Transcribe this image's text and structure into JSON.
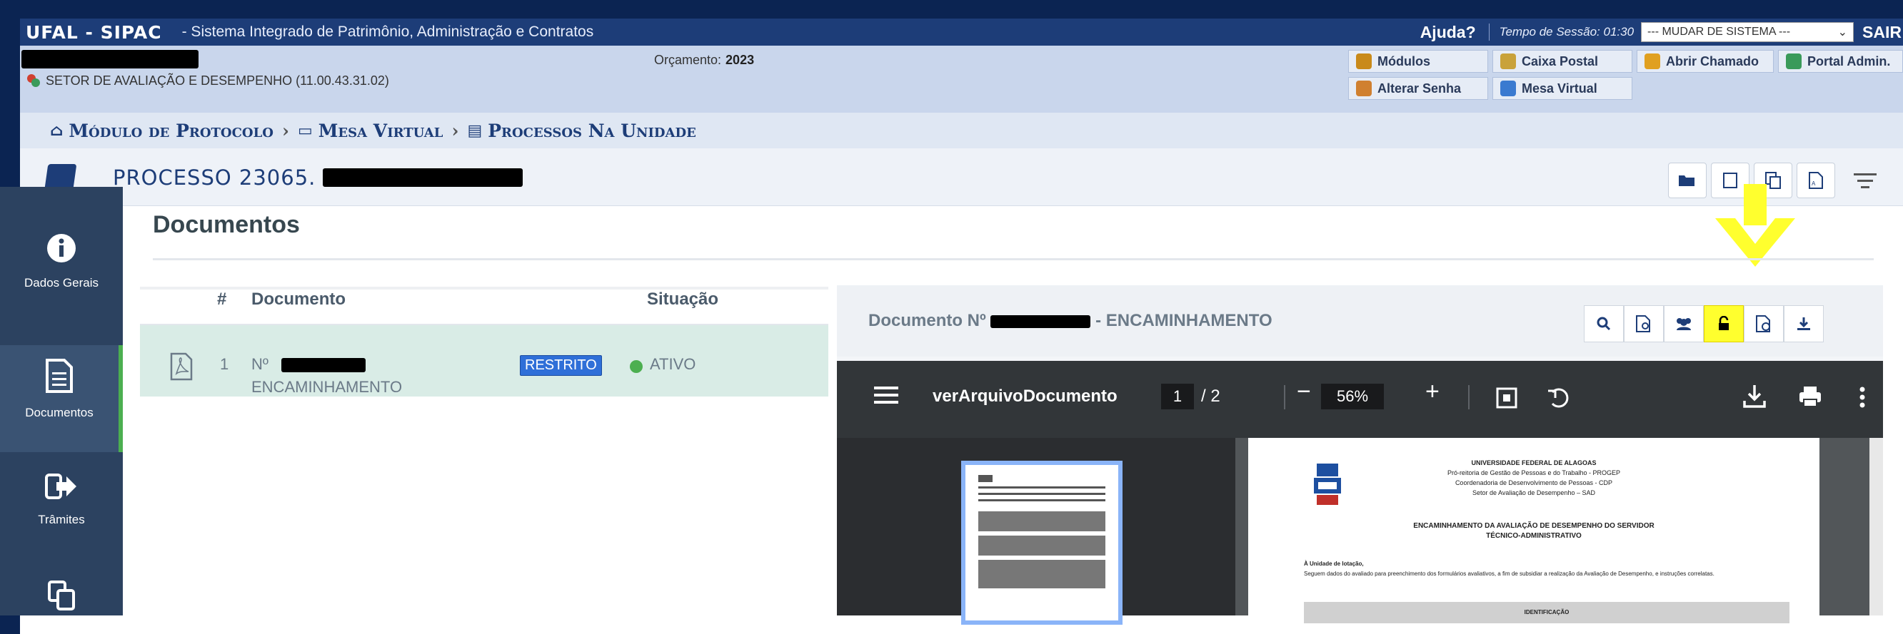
{
  "topbar": {
    "brand": "UFAL - SIPAC",
    "subtitle": "- Sistema Integrado de Patrimônio, Administração e Contratos",
    "help": "Ajuda?",
    "session": "Tempo de Sessão: 01:30",
    "system_select": "--- MUDAR DE SISTEMA ---",
    "exit": "SAIR"
  },
  "info": {
    "unit": "SETOR DE AVALIAÇÃO E DESEMPENHO (11.00.43.31.02)",
    "budget_label": "Orçamento:",
    "budget_year": "2023"
  },
  "quick_links": [
    {
      "label": "Módulos",
      "icon": "cube-icon",
      "color": "#c98a1a"
    },
    {
      "label": "Caixa Postal",
      "icon": "mailbox-icon",
      "color": "#c9a23a"
    },
    {
      "label": "Abrir Chamado",
      "icon": "megaphone-icon",
      "color": "#e0a020"
    },
    {
      "label": "Portal Admin.",
      "icon": "sitemap-icon",
      "color": "#3a9a5a"
    },
    {
      "label": "Alterar Senha",
      "icon": "user-key-icon",
      "color": "#d08030"
    },
    {
      "label": "Mesa Virtual",
      "icon": "desk-icon",
      "color": "#3a7ad0"
    }
  ],
  "breadcrumb": {
    "items": [
      "Módulo de Protocolo",
      "Mesa Virtual",
      "Processos Na Unidade"
    ]
  },
  "process": {
    "title": "PROCESSO 23065."
  },
  "sidebar": {
    "items": [
      {
        "label": "Dados Gerais",
        "icon": "info-icon"
      },
      {
        "label": "Documentos",
        "icon": "document-icon"
      },
      {
        "label": "Trâmites",
        "icon": "forward-icon"
      },
      {
        "label": "",
        "icon": "copy-icon"
      }
    ]
  },
  "documents": {
    "title": "Documentos",
    "columns": [
      "#",
      "Documento",
      "Situação"
    ],
    "rows": [
      {
        "num": "1",
        "doc_prefix": "Nº",
        "doc_type": "ENCAMINHAMENTO",
        "badge": "RESTRITO",
        "status": "ATIVO"
      }
    ]
  },
  "viewer": {
    "title_prefix": "Documento Nº",
    "title_suffix": "- ENCAMINHAMENTO",
    "buttons": [
      "search-icon",
      "doc-search-icon",
      "users-icon",
      "unlock-icon",
      "doc-history-icon",
      "download-icon"
    ],
    "highlight_color": "#ffff2e"
  },
  "pdf": {
    "filename": "verArquivoDocumento",
    "page": "1",
    "total": "/ 2",
    "zoom": "56%"
  },
  "page_text": {
    "l1": "UNIVERSIDADE FEDERAL DE ALAGOAS",
    "l2": "Pró-reitoria de Gestão de Pessoas e do Trabalho - PROGEP",
    "l3": "Coordenadoria de Desenvolvimento de Pessoas - CDP",
    "l4": "Setor de Avaliação de Desempenho – SAD",
    "h1": "ENCAMINHAMENTO DA AVALIAÇÃO DE DESEMPENHO DO SERVIDOR",
    "h2": "TÉCNICO-ADMINISTRATIVO",
    "to": "À Unidade de lotação,",
    "body": "Seguem dados do avaliado para preenchimento dos formulários avaliativos, a fim de subsidiar a realização da Avaliação de Desempenho, e instruções correlatas.",
    "id": "IDENTIFICAÇÃO"
  }
}
